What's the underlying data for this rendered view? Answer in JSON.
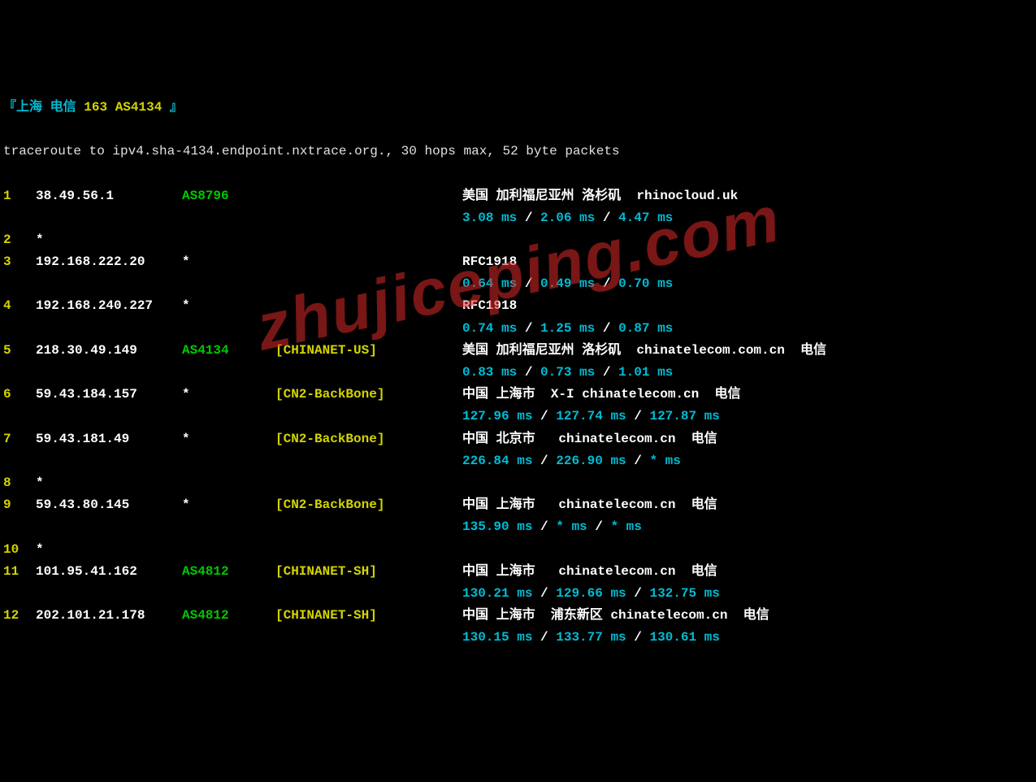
{
  "header": {
    "prefix": "『",
    "city": "上海",
    "isp": "电信",
    "net": "163",
    "asn": "AS4134",
    "suffix": " 』"
  },
  "command": "traceroute to ipv4.sha-4134.endpoint.nxtrace.org., 30 hops max, 52 byte packets",
  "hops": [
    {
      "n": "1",
      "ip": "38.49.56.1",
      "asn": "AS8796",
      "tag": "",
      "loc": "美国 加利福尼亚州 洛杉矶  rhinocloud.uk",
      "t1": "3.08 ms",
      "t2": "2.06 ms",
      "t3": "4.47 ms"
    },
    {
      "n": "2",
      "ip": "*",
      "asn": "",
      "tag": "",
      "loc": "",
      "t1": "",
      "t2": "",
      "t3": ""
    },
    {
      "n": "3",
      "ip": "192.168.222.20",
      "asn": "*",
      "tag": "",
      "loc": "RFC1918",
      "t1": "0.64 ms",
      "t2": "0.49 ms",
      "t3": "0.70 ms"
    },
    {
      "n": "4",
      "ip": "192.168.240.227",
      "asn": "*",
      "tag": "",
      "loc": "RFC1918",
      "t1": "0.74 ms",
      "t2": "1.25 ms",
      "t3": "0.87 ms"
    },
    {
      "n": "5",
      "ip": "218.30.49.149",
      "asn": "AS4134",
      "tag": "[CHINANET-US]",
      "loc": "美国 加利福尼亚州 洛杉矶  chinatelecom.com.cn  电信",
      "t1": "0.83 ms",
      "t2": "0.73 ms",
      "t3": "1.01 ms"
    },
    {
      "n": "6",
      "ip": "59.43.184.157",
      "asn": "*",
      "tag": "[CN2-BackBone]",
      "loc": "中国 上海市  X-I chinatelecom.cn  电信",
      "t1": "127.96 ms",
      "t2": "127.74 ms",
      "t3": "127.87 ms"
    },
    {
      "n": "7",
      "ip": "59.43.181.49",
      "asn": "*",
      "tag": "[CN2-BackBone]",
      "loc": "中国 北京市   chinatelecom.cn  电信",
      "t1": "226.84 ms",
      "t2": "226.90 ms",
      "t3": "* ms"
    },
    {
      "n": "8",
      "ip": "*",
      "asn": "",
      "tag": "",
      "loc": "",
      "t1": "",
      "t2": "",
      "t3": ""
    },
    {
      "n": "9",
      "ip": "59.43.80.145",
      "asn": "*",
      "tag": "[CN2-BackBone]",
      "loc": "中国 上海市   chinatelecom.cn  电信",
      "t1": "135.90 ms",
      "t2": "* ms",
      "t3": "* ms"
    },
    {
      "n": "10",
      "ip": "*",
      "asn": "",
      "tag": "",
      "loc": "",
      "t1": "",
      "t2": "",
      "t3": ""
    },
    {
      "n": "11",
      "ip": "101.95.41.162",
      "asn": "AS4812",
      "tag": "[CHINANET-SH]",
      "loc": "中国 上海市   chinatelecom.cn  电信",
      "t1": "130.21 ms",
      "t2": "129.66 ms",
      "t3": "132.75 ms"
    },
    {
      "n": "12",
      "ip": "202.101.21.178",
      "asn": "AS4812",
      "tag": "[CHINANET-SH]",
      "loc": "中国 上海市  浦东新区 chinatelecom.cn  电信",
      "t1": "130.15 ms",
      "t2": "133.77 ms",
      "t3": "130.61 ms"
    }
  ],
  "watermark": "zhujiceping.com"
}
